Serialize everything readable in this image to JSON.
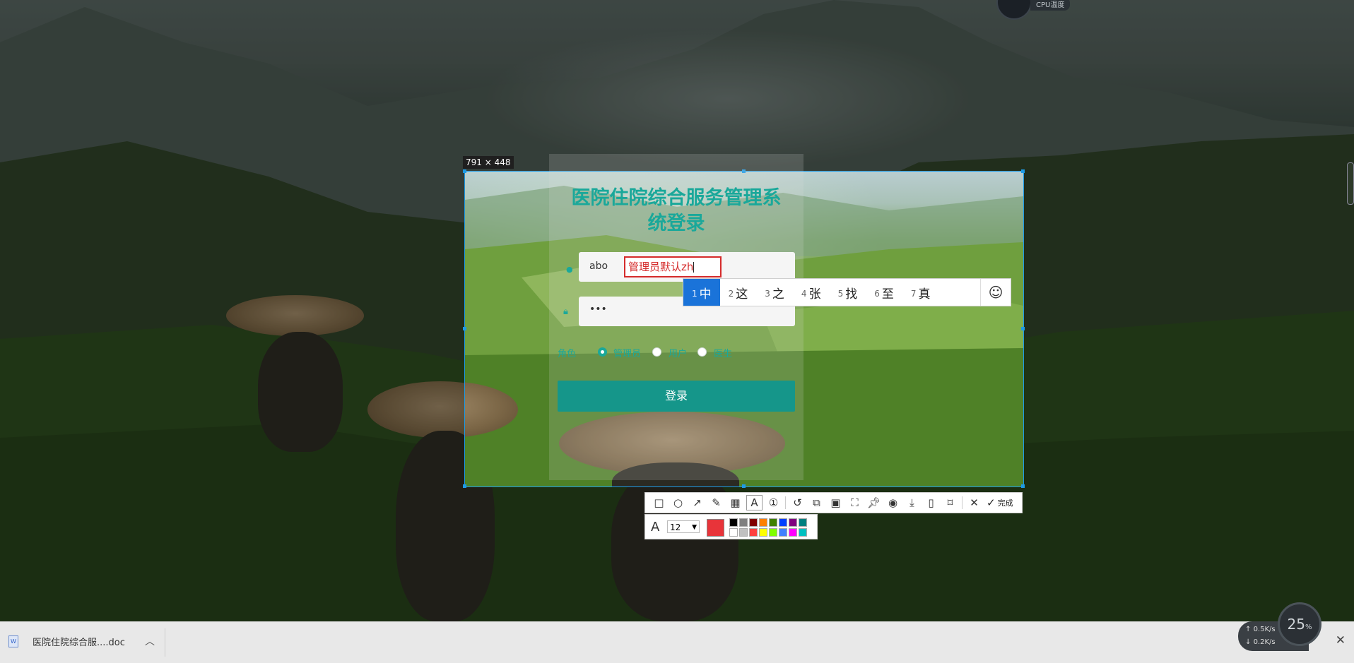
{
  "screenshot_tool": {
    "size_label": "791 × 448",
    "toolbar_done": "完成",
    "font_size": "12",
    "current_color": "#e8343a",
    "swatches": [
      "#000000",
      "#808080",
      "#800000",
      "#ff8000",
      "#408000",
      "#0040ff",
      "#800080",
      "#008080",
      "#ffffff",
      "#c0c0c0",
      "#ff4040",
      "#ffff00",
      "#80ff00",
      "#4080ff",
      "#ff00ff",
      "#00c0c0"
    ],
    "tools": [
      "rectangle-icon",
      "ellipse-icon",
      "arrow-icon",
      "pencil-icon",
      "mosaic-icon",
      "text-icon",
      "number-icon",
      "undo-icon",
      "crop-icon",
      "ocr-icon",
      "fullscreen-icon",
      "pin-icon",
      "record-icon",
      "download-icon",
      "save-icon",
      "bookmark-icon",
      "close-icon",
      "check-icon"
    ]
  },
  "login": {
    "title": "医院住院综合服务管理系统登录",
    "username_value": "abo",
    "ime_composition": "管理员默认zh",
    "password_value": "•••",
    "role_label": "角色",
    "roles": [
      "管理员",
      "用户",
      "医生"
    ],
    "selected_role": "管理员",
    "login_button": "登录"
  },
  "ime_candidates": [
    {
      "num": "1",
      "text": "中"
    },
    {
      "num": "2",
      "text": "这"
    },
    {
      "num": "3",
      "text": "之"
    },
    {
      "num": "4",
      "text": "张"
    },
    {
      "num": "5",
      "text": "找"
    },
    {
      "num": "6",
      "text": "至"
    },
    {
      "num": "7",
      "text": "真"
    }
  ],
  "downloads": {
    "file_name": "医院住院综合服....doc"
  },
  "widgets": {
    "net_up": "0.5",
    "net_down": "0.2",
    "net_unit": "K/s",
    "gauge_value": "25",
    "gauge_unit": "%",
    "cpu_label": "CPU温度"
  }
}
